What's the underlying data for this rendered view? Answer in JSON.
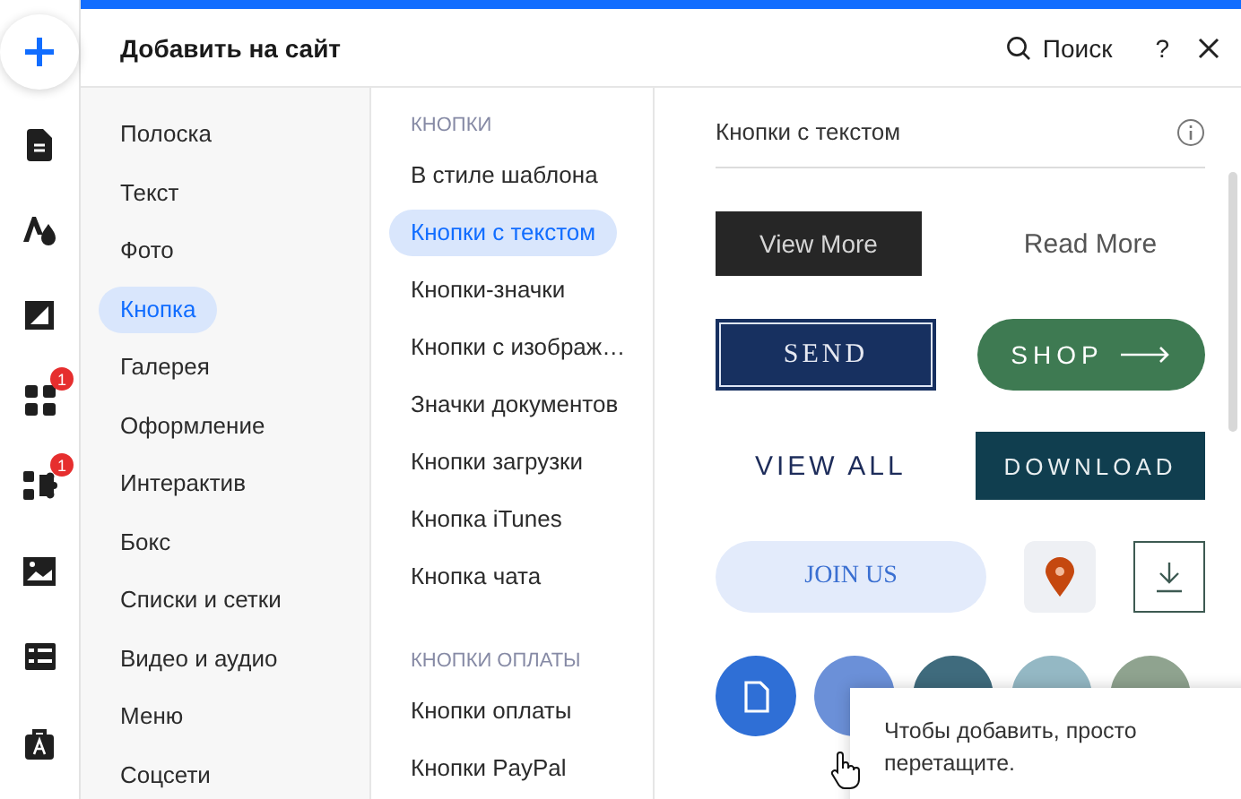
{
  "rail": {
    "items": [
      {
        "kind": "add"
      },
      {
        "kind": "page"
      },
      {
        "kind": "design"
      },
      {
        "kind": "background"
      },
      {
        "kind": "apps",
        "badge": "1"
      },
      {
        "kind": "plugins",
        "badge": "1"
      },
      {
        "kind": "media"
      },
      {
        "kind": "table"
      },
      {
        "kind": "store"
      }
    ]
  },
  "panel": {
    "title": "Добавить на сайт",
    "search": "Поиск",
    "help": "?"
  },
  "categories": [
    {
      "label": "Полоска",
      "selected": false
    },
    {
      "label": "Текст",
      "selected": false
    },
    {
      "label": "Фото",
      "selected": false
    },
    {
      "label": "Кнопка",
      "selected": true
    },
    {
      "label": "Галерея",
      "selected": false
    },
    {
      "label": "Оформление",
      "selected": false
    },
    {
      "label": "Интерактив",
      "selected": false
    },
    {
      "label": "Бокс",
      "selected": false
    },
    {
      "label": "Списки и сетки",
      "selected": false
    },
    {
      "label": "Видео и аудио",
      "selected": false
    },
    {
      "label": "Меню",
      "selected": false
    },
    {
      "label": "Соцсети",
      "selected": false
    }
  ],
  "subcategories": [
    {
      "heading": "КНОПКИ",
      "items": [
        {
          "label": "В стиле шаблона",
          "selected": false
        },
        {
          "label": "Кнопки с текстом",
          "selected": true
        },
        {
          "label": "Кнопки-значки",
          "selected": false
        },
        {
          "label": "Кнопки с изображ…",
          "selected": false
        },
        {
          "label": "Значки документов",
          "selected": false
        },
        {
          "label": "Кнопки загрузки",
          "selected": false
        },
        {
          "label": "Кнопка iTunes",
          "selected": false
        },
        {
          "label": "Кнопка чата",
          "selected": false
        }
      ]
    },
    {
      "heading": "КНОПКИ ОПЛАТЫ",
      "items": [
        {
          "label": "Кнопки оплаты",
          "selected": false
        },
        {
          "label": "Кнопки PayPal",
          "selected": false
        }
      ]
    }
  ],
  "preview": {
    "title": "Кнопки с текстом",
    "rows": [
      [
        {
          "kind": "dark",
          "label": "View More"
        },
        {
          "kind": "plain",
          "label": "Read More"
        }
      ],
      [
        {
          "kind": "framed",
          "label": "SEND"
        },
        {
          "kind": "pill-arrow",
          "label": "SHOP"
        }
      ],
      [
        {
          "kind": "spaced",
          "label": "VIEW ALL"
        },
        {
          "kind": "teal",
          "label": "DOWNLOAD"
        }
      ],
      [
        {
          "kind": "soft",
          "label": "JOIN US"
        },
        {
          "kind": "pin"
        },
        {
          "kind": "download"
        }
      ]
    ],
    "circles": [
      {
        "color": "#2f6fd6"
      },
      {
        "color": "#6b90d8"
      },
      {
        "color": "#3f6b7d"
      },
      {
        "color": "#94b8c4"
      },
      {
        "color": "#8fa38f"
      }
    ]
  },
  "tooltip": {
    "text": "Чтобы добавить, просто перетащите."
  }
}
